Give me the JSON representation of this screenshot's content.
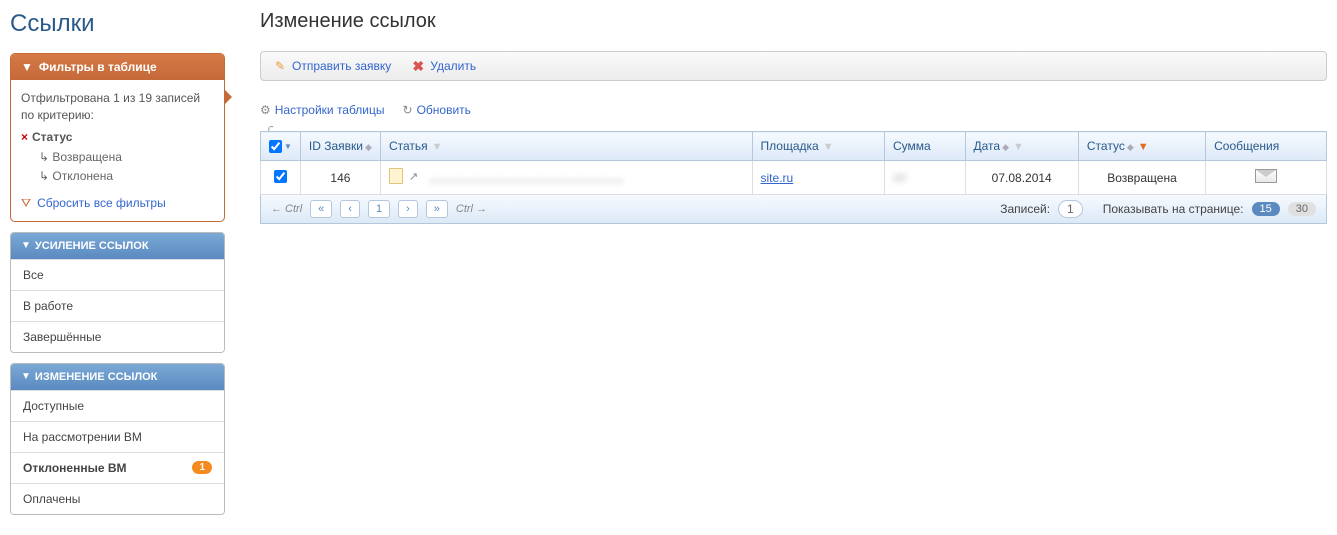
{
  "sidebar": {
    "title": "Ссылки",
    "filters": {
      "header": "Фильтры в таблице",
      "info": "Отфильтрована 1 из 19 записей по критерию:",
      "status_label": "Статус",
      "values": [
        "Возвращена",
        "Отклонена"
      ],
      "reset": "Сбросить все фильтры"
    },
    "nav1": {
      "header": "УСИЛЕНИЕ ССЫЛОК",
      "items": [
        "Все",
        "В работе",
        "Завершённые"
      ]
    },
    "nav2": {
      "header": "ИЗМЕНЕНИЕ ССЫЛОК",
      "items": [
        {
          "label": "Доступные",
          "badge": ""
        },
        {
          "label": "На рассмотрении ВМ",
          "badge": ""
        },
        {
          "label": "Отклоненные ВМ",
          "badge": "1"
        },
        {
          "label": "Оплачены",
          "badge": ""
        }
      ]
    }
  },
  "main": {
    "title": "Изменение ссылок",
    "toolbar": {
      "send": "Отправить заявку",
      "delete": "Удалить"
    },
    "settings": {
      "table_settings": "Настройки таблицы",
      "refresh": "Обновить"
    },
    "table": {
      "headers": {
        "id": "ID Заявки",
        "article": "Статья",
        "site": "Площадка",
        "sum": "Сумма",
        "date": "Дата",
        "status": "Статус",
        "messages": "Сообщения"
      },
      "row": {
        "id": "146",
        "article_blur": "———————————————",
        "site": "site.ru",
        "sum": "////",
        "date": "07.08.2014",
        "status": "Возвращена"
      }
    },
    "footer": {
      "ctrl_left": "← Ctrl",
      "first": "«",
      "prev": "‹",
      "page": "1",
      "next": "›",
      "last": "»",
      "ctrl_right": "Ctrl →",
      "records_label": "Записей:",
      "records_count": "1",
      "per_page_label": "Показывать на странице:",
      "sizes": [
        "15",
        "30"
      ]
    }
  }
}
